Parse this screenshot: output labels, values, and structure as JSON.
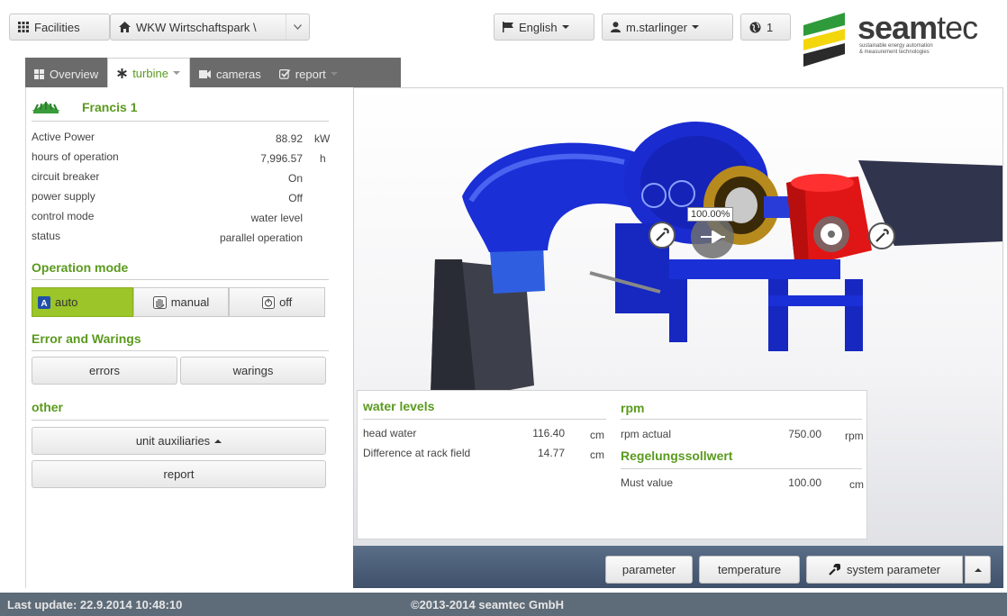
{
  "topbar": {
    "facilities_label": "Facilities",
    "site_name": "WKW Wirtschaftspark \\",
    "language_label": "English",
    "user_label": "m.starlinger",
    "globe_count": "1"
  },
  "logo": {
    "brand_main": "seam",
    "brand_end": "tec",
    "tagline_1": "sustainable energy automation",
    "tagline_2": "& measurement technologies"
  },
  "tabs": [
    {
      "label": "Overview"
    },
    {
      "label": "turbine"
    },
    {
      "label": "cameras"
    },
    {
      "label": "report"
    }
  ],
  "unit": {
    "title": "Francis 1",
    "rows": [
      {
        "label": "Active Power",
        "value": "88.92",
        "unit": "kW"
      },
      {
        "label": "hours of operation",
        "value": "7,996.57",
        "unit": "h"
      },
      {
        "label": "circuit breaker",
        "value": "On",
        "unit": ""
      },
      {
        "label": "power supply",
        "value": "Off",
        "unit": ""
      },
      {
        "label": "control mode",
        "value": "water level",
        "unit": ""
      },
      {
        "label": "status",
        "value": "parallel operation",
        "unit": ""
      }
    ]
  },
  "operation_mode": {
    "title": "Operation mode",
    "auto": "auto",
    "manual": "manual",
    "off": "off"
  },
  "errors": {
    "title": "Error and Warings",
    "errors_btn": "errors",
    "warnings_btn": "warings"
  },
  "other": {
    "title": "other",
    "aux_btn": "unit auxiliaries",
    "report_btn": "report"
  },
  "viewer": {
    "badge": "100.00%"
  },
  "water_levels": {
    "title": "water levels",
    "rows": [
      {
        "label": "head water",
        "value": "116.40",
        "unit": "cm"
      },
      {
        "label": "Difference at rack field",
        "value": "14.77",
        "unit": "cm"
      }
    ]
  },
  "rpm": {
    "title": "rpm",
    "label": "rpm actual",
    "value": "750.00",
    "unit": "rpm"
  },
  "regelung": {
    "title": "Regelungssollwert",
    "label": "Must value",
    "value": "100.00",
    "unit": "cm"
  },
  "bottom_buttons": {
    "parameter": "parameter",
    "temperature": "temperature",
    "system_parameter": "system parameter"
  },
  "footer": {
    "last_update": "Last update: 22.9.2014 10:48:10",
    "copyright": "©2013-2014 seamtec GmbH"
  },
  "colors": {
    "accent_green": "#5a9a1e",
    "auto_green": "#9bc528",
    "turbine_blue": "#1a2bd8",
    "generator_red": "#e01515"
  }
}
